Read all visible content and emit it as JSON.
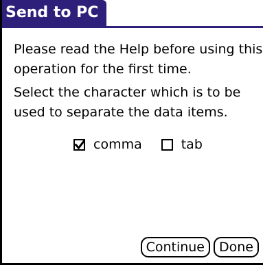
{
  "dialog": {
    "title": "Send to PC",
    "help_message": "Please read the Help before using this\noperation for the first time.",
    "instruction": "Select the character which is to be\nused to separate the data items.",
    "options": [
      {
        "label": "comma",
        "checked": true
      },
      {
        "label": "tab",
        "checked": false
      }
    ],
    "buttons": {
      "continue_label": "Continue",
      "done_label": "Done"
    }
  },
  "colors": {
    "title_bar": "#2e1f7a",
    "title_text": "#ffffff",
    "frame": "#000000"
  }
}
